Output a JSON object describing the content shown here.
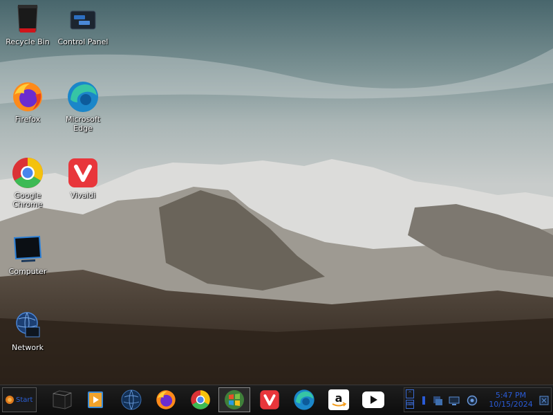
{
  "desktop": {
    "icons": [
      {
        "label": "Recycle Bin",
        "icon": "recycle-bin-icon"
      },
      {
        "label": "Control Panel",
        "icon": "control-panel-icon"
      },
      {
        "label": "Firefox",
        "icon": "firefox-icon"
      },
      {
        "label": "Microsoft Edge",
        "icon": "edge-icon"
      },
      {
        "label": "Google Chrome",
        "icon": "chrome-icon"
      },
      {
        "label": "Vivaldi",
        "icon": "vivaldi-icon"
      },
      {
        "label": "Computer",
        "icon": "computer-icon"
      },
      {
        "label": "Network",
        "icon": "network-icon"
      }
    ]
  },
  "taskbar": {
    "start_label": "Start",
    "pinned": [
      {
        "icon": "file-explorer-icon"
      },
      {
        "icon": "media-player-icon"
      },
      {
        "icon": "globe-icon"
      },
      {
        "icon": "firefox-icon"
      },
      {
        "icon": "chrome-icon"
      },
      {
        "icon": "windows-logo-icon",
        "active": true
      },
      {
        "icon": "vivaldi-icon"
      },
      {
        "icon": "edge-icon"
      },
      {
        "icon": "amazon-icon"
      },
      {
        "icon": "youtube-icon"
      }
    ],
    "tray": {
      "time": "5:47 PM",
      "date": "10/15/2024",
      "icons": [
        "action-center-icon",
        "network-tray-icon",
        "display-tray-icon",
        "security-tray-icon",
        "notification-icon"
      ],
      "expand_glyph": "^",
      "keyboard_glyph": "⌨"
    }
  },
  "colors": {
    "accent": "#2a5bd6",
    "taskbar_bg": "#111111"
  }
}
